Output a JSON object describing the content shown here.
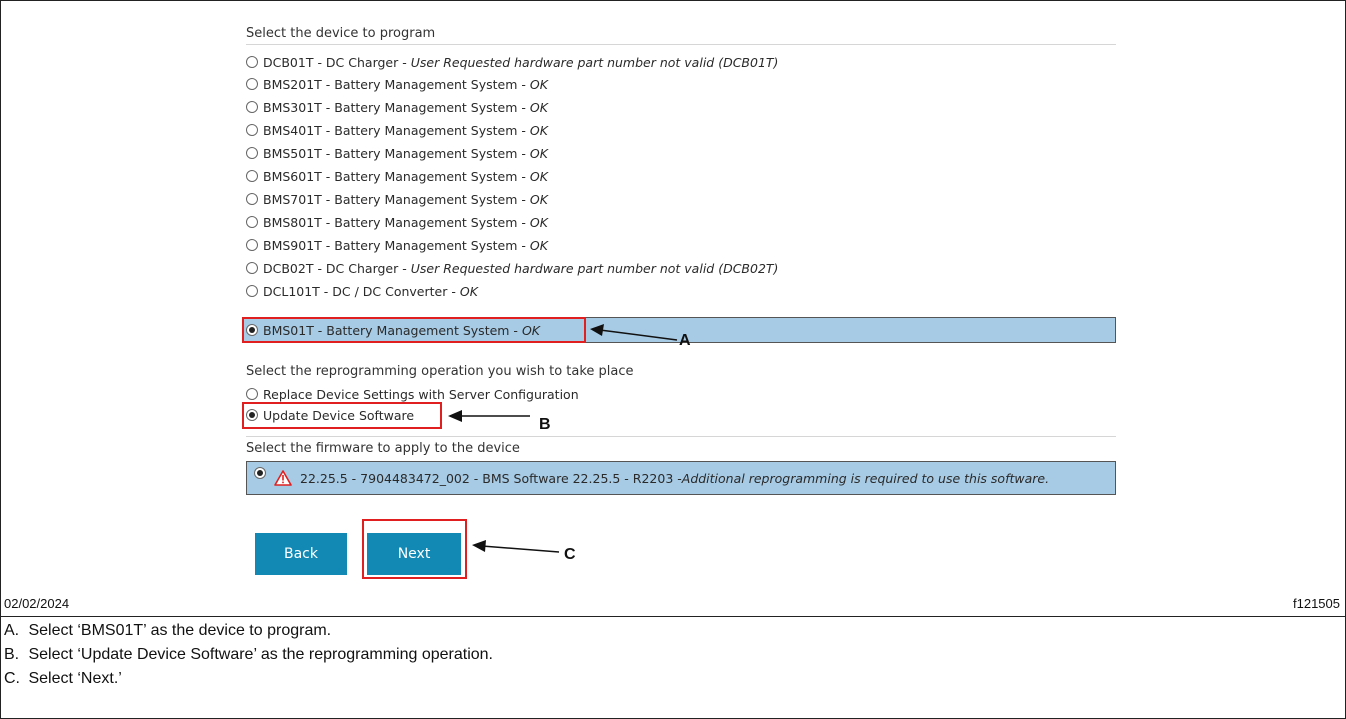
{
  "device_section": {
    "label": "Select the device to program",
    "devices": [
      {
        "name": "DCB01T - DC Charger - ",
        "status": "User Requested hardware part number not valid (DCB01T)"
      },
      {
        "name": "BMS201T - Battery Management System - ",
        "status": "OK"
      },
      {
        "name": "BMS301T - Battery Management System - ",
        "status": "OK"
      },
      {
        "name": "BMS401T - Battery Management System - ",
        "status": "OK"
      },
      {
        "name": "BMS501T - Battery Management System - ",
        "status": "OK"
      },
      {
        "name": "BMS601T - Battery Management System - ",
        "status": "OK"
      },
      {
        "name": "BMS701T - Battery Management System - ",
        "status": "OK"
      },
      {
        "name": "BMS801T - Battery Management System - ",
        "status": "OK"
      },
      {
        "name": "BMS901T - Battery Management System - ",
        "status": "OK"
      },
      {
        "name": "DCB02T - DC Charger - ",
        "status": "User Requested hardware part number not valid (DCB02T)"
      },
      {
        "name": "DCL101T - DC / DC Converter - ",
        "status": "OK"
      }
    ],
    "selected": {
      "name": "BMS01T - Battery Management System - ",
      "status": "OK"
    }
  },
  "operation_section": {
    "label": "Select the reprogramming operation you wish to take place",
    "options": [
      {
        "label": "Replace Device Settings with Server Configuration",
        "selected": false
      },
      {
        "label": "Update Device Software",
        "selected": true
      }
    ]
  },
  "firmware_section": {
    "label": "Select the firmware to apply to the device",
    "item": {
      "warning_icon": "warning-triangle-icon",
      "text": "22.25.5 - 7904483472_002 - BMS Software 22.25.5 - R2203 - ",
      "note": "Additional reprogramming is required to use this software."
    }
  },
  "buttons": {
    "back": "Back",
    "next": "Next"
  },
  "callouts": {
    "a": "A",
    "b": "B",
    "c": "C"
  },
  "footer": {
    "date": "02/02/2024",
    "figure_id": "f121505"
  },
  "captions": [
    {
      "letter": "A.",
      "text": "Select ‘BMS01T’ as the device to program."
    },
    {
      "letter": "B.",
      "text": "Select ‘Update Device Software’ as the reprogramming operation."
    },
    {
      "letter": "C.",
      "text": "Select ‘Next.’"
    }
  ],
  "colors": {
    "selection": "#a7cbe5",
    "button": "#1288b4",
    "highlight": "#e02020",
    "warning": "#e02020"
  }
}
